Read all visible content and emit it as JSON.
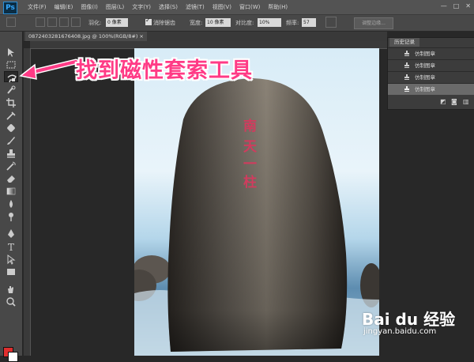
{
  "app": {
    "logo": "Ps",
    "window_controls": [
      "—",
      "□",
      "✕"
    ]
  },
  "menu": [
    "文件(F)",
    "编辑(E)",
    "图像(I)",
    "图层(L)",
    "文字(Y)",
    "选择(S)",
    "滤镜(T)",
    "视图(V)",
    "窗口(W)",
    "帮助(H)"
  ],
  "options": {
    "feather_label": "羽化:",
    "feather_value": "0 像素",
    "antialias_label": "消除锯齿",
    "width_label": "宽度:",
    "width_value": "10 像素",
    "contrast_label": "对比度:",
    "contrast_value": "10%",
    "frequency_label": "频率:",
    "frequency_value": "57",
    "refine_edge": "调整边缘..."
  },
  "document": {
    "tab_label": "08724032816764​08.jpg @ 100%(RGB/8#) ×"
  },
  "history": {
    "tab_label": "历史记录",
    "items": [
      {
        "label": "仿制图章",
        "active": false
      },
      {
        "label": "仿制图章",
        "active": false
      },
      {
        "label": "仿制图章",
        "active": false
      },
      {
        "label": "仿制图章",
        "active": true
      }
    ]
  },
  "annotation": {
    "text": "找到磁性套索工具",
    "color": "#ff3b86"
  },
  "canvas": {
    "inscription": [
      "南",
      "天",
      "一",
      "柱"
    ]
  },
  "watermark": {
    "logo": "Bai du 经验",
    "url": "jingyan.baidu.com"
  },
  "colors": {
    "foreground": "#e02e2e",
    "background": "#ffffff",
    "accent": "#ff3b86"
  }
}
